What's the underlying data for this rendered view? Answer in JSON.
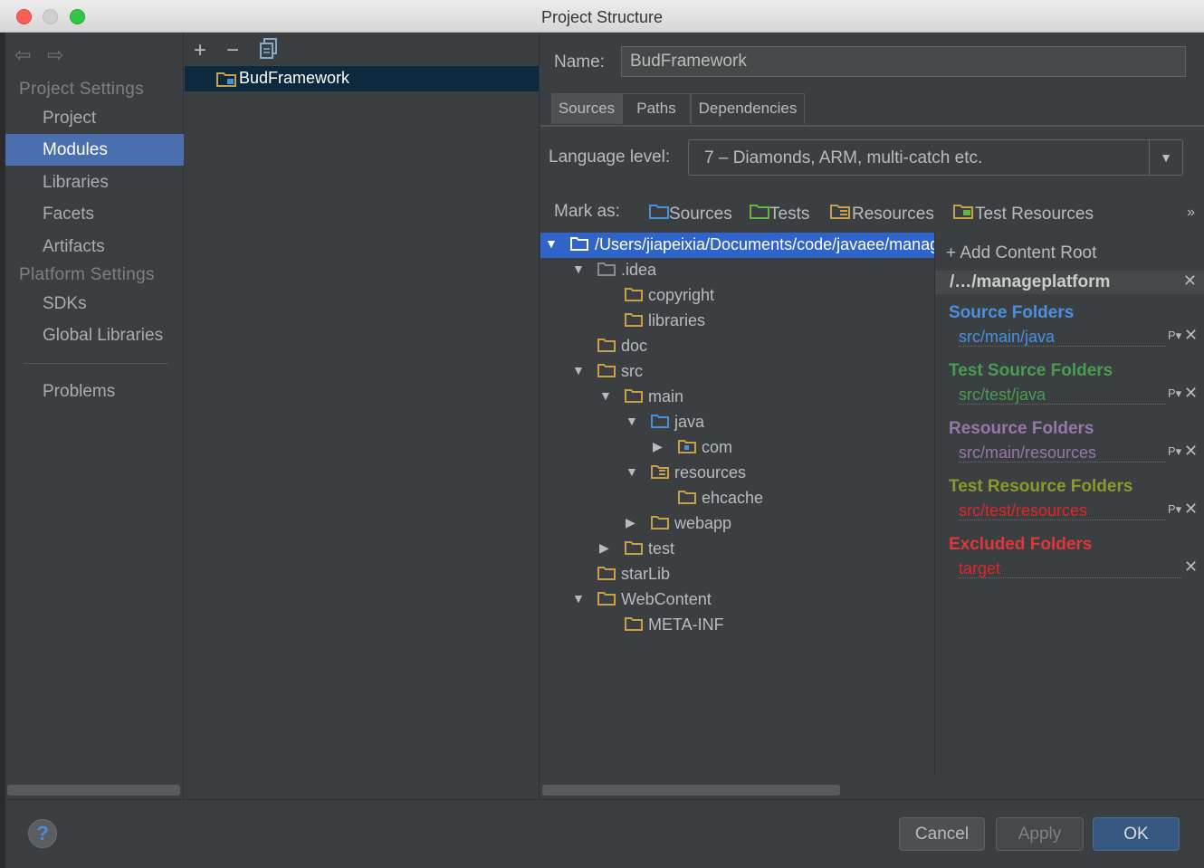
{
  "window": {
    "title": "Project Structure"
  },
  "sidebar": {
    "project_settings_header": "Project Settings",
    "platform_settings_header": "Platform Settings",
    "items": [
      {
        "label": "Project"
      },
      {
        "label": "Modules",
        "selected": true
      },
      {
        "label": "Libraries"
      },
      {
        "label": "Facets"
      },
      {
        "label": "Artifacts"
      },
      {
        "label": "SDKs"
      },
      {
        "label": "Global Libraries"
      },
      {
        "label": "Problems"
      }
    ]
  },
  "modules": {
    "toolbar": {
      "add": "+",
      "remove": "−",
      "copy_icon": "copy-icon"
    },
    "items": [
      {
        "label": "BudFramework",
        "selected": true
      }
    ]
  },
  "module": {
    "name_label": "Name:",
    "name_value": "BudFramework",
    "tabs": [
      {
        "label": "Sources",
        "active": true
      },
      {
        "label": "Paths"
      },
      {
        "label": "Dependencies"
      }
    ],
    "language_level_label": "Language level:",
    "language_level_value": "7 – Diamonds, ARM, multi-catch etc.",
    "mark_as_label": "Mark as:",
    "mark_as": [
      {
        "label": "Sources",
        "color": "#4a90d9"
      },
      {
        "label": "Tests",
        "color": "#62b543"
      },
      {
        "label": "Resources",
        "color": "#c8a04a"
      },
      {
        "label": "Test Resources",
        "color": "#c8a04a"
      }
    ],
    "more": "»"
  },
  "tree": [
    {
      "label": "/Users/jiapeixia/Documents/code/javaee/manageplatform",
      "expanded": true,
      "selected": true,
      "kind": "source-root"
    },
    {
      "label": ".idea",
      "expanded": true,
      "kind": "folder-grey"
    },
    {
      "label": "copyright",
      "kind": "folder"
    },
    {
      "label": "libraries",
      "kind": "folder"
    },
    {
      "label": "doc",
      "kind": "folder"
    },
    {
      "label": "src",
      "expanded": true,
      "kind": "folder"
    },
    {
      "label": "main",
      "expanded": true,
      "kind": "folder"
    },
    {
      "label": "java",
      "expanded": true,
      "kind": "source-folder"
    },
    {
      "label": "com",
      "expanded": false,
      "kind": "package"
    },
    {
      "label": "resources",
      "expanded": true,
      "kind": "resource-folder"
    },
    {
      "label": "ehcache",
      "kind": "folder"
    },
    {
      "label": "webapp",
      "expanded": false,
      "kind": "folder"
    },
    {
      "label": "test",
      "expanded": false,
      "kind": "folder"
    },
    {
      "label": "starLib",
      "kind": "folder"
    },
    {
      "label": "WebContent",
      "expanded": true,
      "kind": "folder"
    },
    {
      "label": "META-INF",
      "kind": "folder"
    }
  ],
  "content_roots": {
    "add_label": "+ Add Content Root",
    "root_path": "/…/manageplatform",
    "sections": [
      {
        "title": "Source Folders",
        "path": "src/main/java",
        "title_color": "#4a90e2",
        "path_color": "#4a90e2"
      },
      {
        "title": "Test Source Folders",
        "path": "src/test/java",
        "title_color": "#499c54",
        "path_color": "#499c54"
      },
      {
        "title": "Resource Folders",
        "path": "src/main/resources",
        "title_color": "#9876aa",
        "path_color": "#9876aa"
      },
      {
        "title": "Test Resource Folders",
        "path": "src/test/resources",
        "title_color": "#8a9a2a",
        "path_color": "#e0262a"
      },
      {
        "title": "Excluded Folders",
        "path": "target",
        "title_color": "#e0353a",
        "path_color": "#e0262a"
      }
    ]
  },
  "buttons": {
    "help": "?",
    "cancel": "Cancel",
    "apply": "Apply",
    "ok": "OK"
  }
}
